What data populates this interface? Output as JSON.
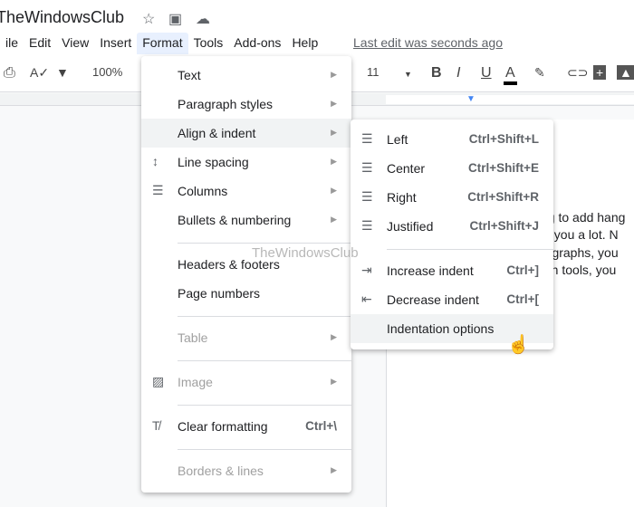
{
  "doc": {
    "title": "TheWindowsClub",
    "last_edit": "Last edit was seconds ago",
    "lines": [
      "ng to add hang",
      "lp you a lot. N",
      "ragraphs, you",
      "oth tools, you"
    ],
    "watermark": "TheWindowsClub"
  },
  "menubar": [
    "ile",
    "Edit",
    "View",
    "Insert",
    "Format",
    "Tools",
    "Add-ons",
    "Help"
  ],
  "toolbar": {
    "zoom": "100%",
    "font_size": "11"
  },
  "format_menu": [
    {
      "label": "Text",
      "arrow": true
    },
    {
      "label": "Paragraph styles",
      "arrow": true
    },
    {
      "label": "Align & indent",
      "arrow": true,
      "highlighted": true
    },
    {
      "label": "Line spacing",
      "arrow": true,
      "icon": "line-spacing-icon"
    },
    {
      "label": "Columns",
      "arrow": true,
      "icon": "columns-icon"
    },
    {
      "label": "Bullets & numbering",
      "arrow": true
    },
    {
      "label": "Headers & footers"
    },
    {
      "label": "Page numbers"
    },
    {
      "label": "Table",
      "arrow": true,
      "disabled": true
    },
    {
      "label": "Image",
      "arrow": true,
      "disabled": true,
      "icon": "image-icon"
    },
    {
      "label": "Clear formatting",
      "shortcut": "Ctrl+\\",
      "icon": "clear-formatting-icon"
    },
    {
      "label": "Borders & lines",
      "arrow": true,
      "disabled": true
    }
  ],
  "align_menu": [
    {
      "label": "Left",
      "shortcut": "Ctrl+Shift+L",
      "icon": "align-left-icon"
    },
    {
      "label": "Center",
      "shortcut": "Ctrl+Shift+E",
      "icon": "align-center-icon"
    },
    {
      "label": "Right",
      "shortcut": "Ctrl+Shift+R",
      "icon": "align-right-icon"
    },
    {
      "label": "Justified",
      "shortcut": "Ctrl+Shift+J",
      "icon": "align-justify-icon"
    },
    {
      "label": "Increase indent",
      "shortcut": "Ctrl+]",
      "icon": "increase-indent-icon"
    },
    {
      "label": "Decrease indent",
      "shortcut": "Ctrl+[",
      "icon": "decrease-indent-icon"
    },
    {
      "label": "Indentation options",
      "highlighted": true
    }
  ]
}
